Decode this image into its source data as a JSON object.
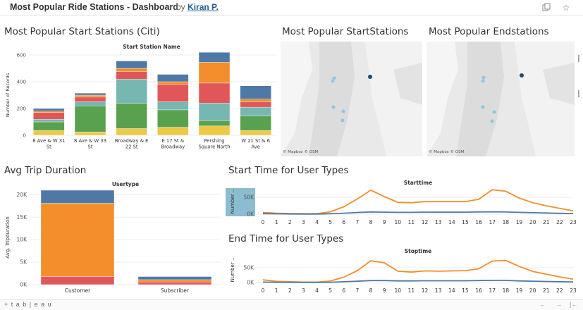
{
  "header": {
    "title": "Most Popular Ride Stations - Dashboard",
    "by": "by",
    "author": "Kiran P.",
    "icons": [
      "copy-icon",
      "star-icon"
    ]
  },
  "sheets": {
    "start_stations": "Most Popular Start Stations (Citi)",
    "map_start": "Most Popular StartStations",
    "map_end": "Most Popular Endstations",
    "trip_duration": "Avg Trip Duration",
    "start_time": "Start Time for User Types",
    "end_time": "End Time for User Types"
  },
  "map_attribution": "© Mapbox © OSM",
  "footer": {
    "logo": "+ t a b | e a u",
    "nav": [
      "←",
      "→",
      "|←"
    ]
  },
  "colors": {
    "blue": "#4e79a7",
    "orange": "#f28e2b",
    "red": "#e15759",
    "teal": "#76b7b2",
    "green": "#59a14f",
    "yellow": "#edc948",
    "lightblue": "#8cc6e6",
    "darkblue": "#1f4e79"
  },
  "chart_data": [
    {
      "id": "start_stations",
      "type": "bar",
      "stacked": true,
      "title": "Start Station Name",
      "ylabel": "Number of Records",
      "ylim": [
        0,
        600
      ],
      "yticks": [
        0,
        200,
        400,
        600
      ],
      "categories": [
        "8 Ave & W 31 St",
        "8 Ave & W 33 St",
        "Broadway & E 22 St",
        "E 17 St & Broadway",
        "Pershing Square North",
        "W 21 St & 6 Ave"
      ],
      "series": [
        {
          "color": "#edc948",
          "values": [
            35,
            25,
            50,
            60,
            70,
            35
          ]
        },
        {
          "color": "#59a14f",
          "values": [
            65,
            195,
            190,
            130,
            40,
            110
          ]
        },
        {
          "color": "#76b7b2",
          "values": [
            20,
            30,
            180,
            60,
            130,
            65
          ]
        },
        {
          "color": "#e15759",
          "values": [
            50,
            35,
            55,
            130,
            150,
            40
          ]
        },
        {
          "color": "#f28e2b",
          "values": [
            10,
            15,
            25,
            20,
            155,
            20
          ]
        },
        {
          "color": "#4e79a7",
          "values": [
            20,
            15,
            55,
            55,
            75,
            100
          ]
        }
      ]
    },
    {
      "id": "trip_duration",
      "type": "bar",
      "stacked": true,
      "title": "Usertype",
      "ylabel": "Avg. Tripduration",
      "ylim": [
        0,
        21000
      ],
      "yticks": [
        "0K",
        "5K",
        "10K",
        "15K",
        "20K"
      ],
      "categories": [
        "Customer",
        "Subscriber"
      ],
      "series": [
        {
          "color": "#e15759",
          "values": [
            1800,
            600
          ]
        },
        {
          "color": "#f28e2b",
          "values": [
            16300,
            500
          ]
        },
        {
          "color": "#4e79a7",
          "values": [
            2900,
            700
          ]
        }
      ]
    },
    {
      "id": "start_time",
      "type": "line",
      "title": "Starttime",
      "ylabel": "Number ..",
      "ylim": [
        0,
        75000
      ],
      "yticks": [
        "0K",
        "50K"
      ],
      "x": [
        0,
        1,
        2,
        3,
        4,
        5,
        6,
        7,
        8,
        9,
        10,
        11,
        12,
        13,
        14,
        15,
        16,
        17,
        18,
        19,
        20,
        21,
        22,
        23
      ],
      "series": [
        {
          "color": "#f28e2b",
          "values": [
            5000,
            3000,
            2000,
            1500,
            1500,
            7000,
            22000,
            45000,
            71000,
            52000,
            35000,
            34000,
            37000,
            37000,
            37000,
            37000,
            44000,
            72000,
            68000,
            48000,
            34000,
            25000,
            17000,
            10000
          ]
        },
        {
          "color": "#4e79a7",
          "values": [
            1500,
            1000,
            600,
            400,
            500,
            1200,
            3000,
            5000,
            6500,
            6000,
            5500,
            5500,
            6000,
            6000,
            6000,
            6000,
            6500,
            7000,
            6500,
            5500,
            4500,
            3500,
            2500,
            2000
          ]
        }
      ]
    },
    {
      "id": "end_time",
      "type": "line",
      "title": "Stoptime",
      "ylabel": "Number ..",
      "ylim": [
        0,
        85000
      ],
      "yticks": [
        "0K",
        "50K"
      ],
      "x": [
        0,
        1,
        2,
        3,
        4,
        5,
        6,
        7,
        8,
        9,
        10,
        11,
        12,
        13,
        14,
        15,
        16,
        17,
        18,
        19,
        20,
        21,
        22,
        23
      ],
      "series": [
        {
          "color": "#f28e2b",
          "values": [
            9000,
            4000,
            2500,
            1500,
            1500,
            5000,
            18000,
            40000,
            73000,
            66000,
            38000,
            35000,
            39000,
            38000,
            39000,
            40000,
            46000,
            72000,
            74000,
            54000,
            37000,
            28000,
            19000,
            11000
          ]
        },
        {
          "color": "#4e79a7",
          "values": [
            1500,
            1000,
            600,
            400,
            400,
            1000,
            2500,
            4500,
            6500,
            6500,
            5500,
            5500,
            6000,
            6000,
            6000,
            6000,
            6500,
            7000,
            7000,
            5500,
            4500,
            3500,
            2500,
            2000
          ]
        }
      ]
    }
  ]
}
